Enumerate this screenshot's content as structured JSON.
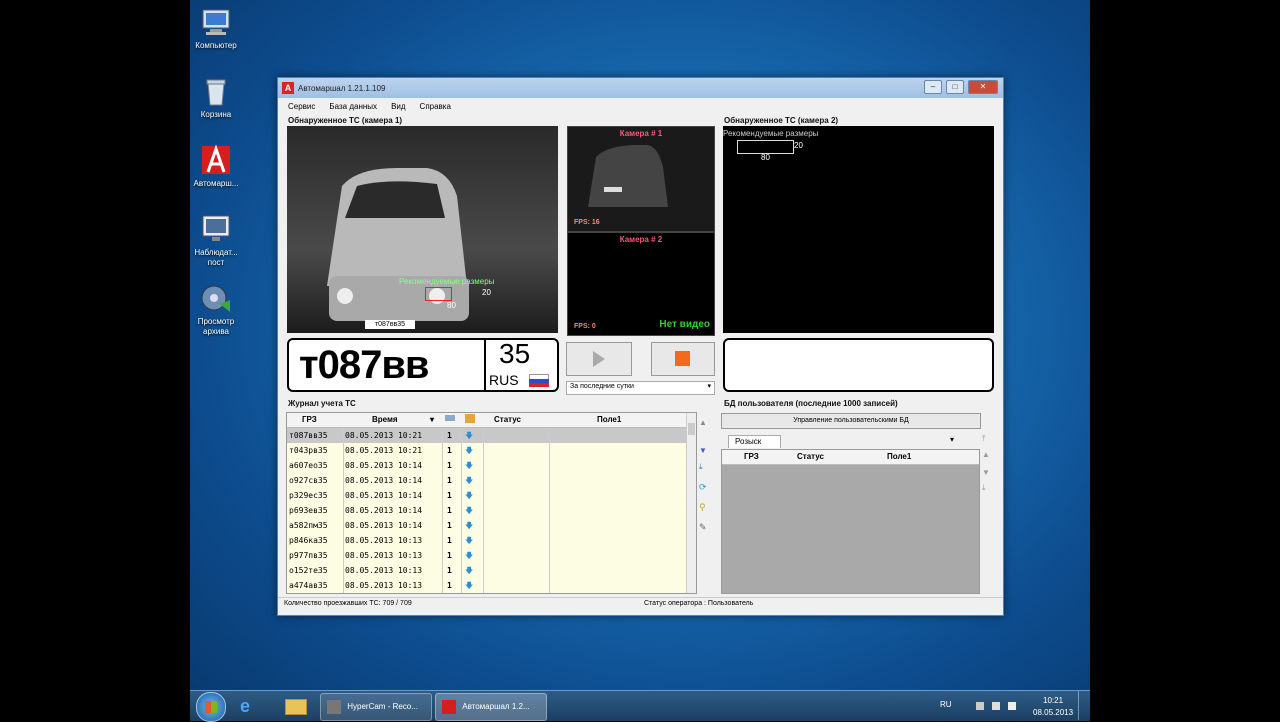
{
  "desktop": {
    "icons": [
      {
        "label": "Компьютер"
      },
      {
        "label": "Корзина"
      },
      {
        "label": "Автомарш..."
      },
      {
        "label": "Наблюдат... пост"
      },
      {
        "label": "Просмотр архива"
      }
    ]
  },
  "window": {
    "title": "Автомаршал 1.21.1.109",
    "menu": [
      "Сервис",
      "База данных",
      "Вид",
      "Справка"
    ],
    "cam1": {
      "title": "Обнаруженное ТС (камера 1)",
      "overlay_label": "Рекомендуемые размеры",
      "overlay_w": "20",
      "overlay_h": "80",
      "car_plate": "т087вв35"
    },
    "cam2": {
      "title": "Обнаруженное ТС (камера 2)",
      "overlay_label": "Рекомендуемые размеры",
      "overlay_w": "20",
      "overlay_h": "80"
    },
    "preview1": {
      "label": "Камера # 1",
      "fps": "FPS: 16"
    },
    "preview2": {
      "label": "Камера # 2",
      "fps": "FPS: 0",
      "status": "Нет видео"
    },
    "plate": {
      "number": "т087вв",
      "region": "35",
      "country": "RUS"
    },
    "period_select": "За последние сутки",
    "journal": {
      "title": "Журнал учета ТС",
      "columns": [
        "ГРЗ",
        "Время",
        "",
        "",
        "Статус",
        "Поле1"
      ],
      "rows": [
        {
          "plate": "т087вв35",
          "time": "08.05.2013 10:21",
          "n": "1"
        },
        {
          "plate": "т043рв35",
          "time": "08.05.2013 10:21",
          "n": "1"
        },
        {
          "plate": "а607ео35",
          "time": "08.05.2013 10:14",
          "n": "1"
        },
        {
          "plate": "о927св35",
          "time": "08.05.2013 10:14",
          "n": "1"
        },
        {
          "plate": "р329ес35",
          "time": "08.05.2013 10:14",
          "n": "1"
        },
        {
          "plate": "р693ев35",
          "time": "08.05.2013 10:14",
          "n": "1"
        },
        {
          "plate": "а582пм35",
          "time": "08.05.2013 10:14",
          "n": "1"
        },
        {
          "plate": "р846ка35",
          "time": "08.05.2013 10:13",
          "n": "1"
        },
        {
          "plate": "р977пв35",
          "time": "08.05.2013 10:13",
          "n": "1"
        },
        {
          "plate": "о152те35",
          "time": "08.05.2013 10:13",
          "n": "1"
        },
        {
          "plate": "а474ав35",
          "time": "08.05.2013 10:13",
          "n": "1"
        }
      ]
    },
    "userdb": {
      "title": "БД пользователя (последние 1000 записей)",
      "manage_button": "Управление пользовательскими БД",
      "tab": "Розыск",
      "columns": [
        "ГРЗ",
        "Статус",
        "Поле1"
      ]
    },
    "status": {
      "count": "Количество проезжавших ТС: 709 / 709",
      "operator": "Статус оператора : Пользователь"
    }
  },
  "taskbar": {
    "items": [
      "HyperCam - Reco...",
      "Автомаршал 1.2..."
    ],
    "lang": "RU",
    "time": "10:21",
    "date": "08.05.2013"
  }
}
